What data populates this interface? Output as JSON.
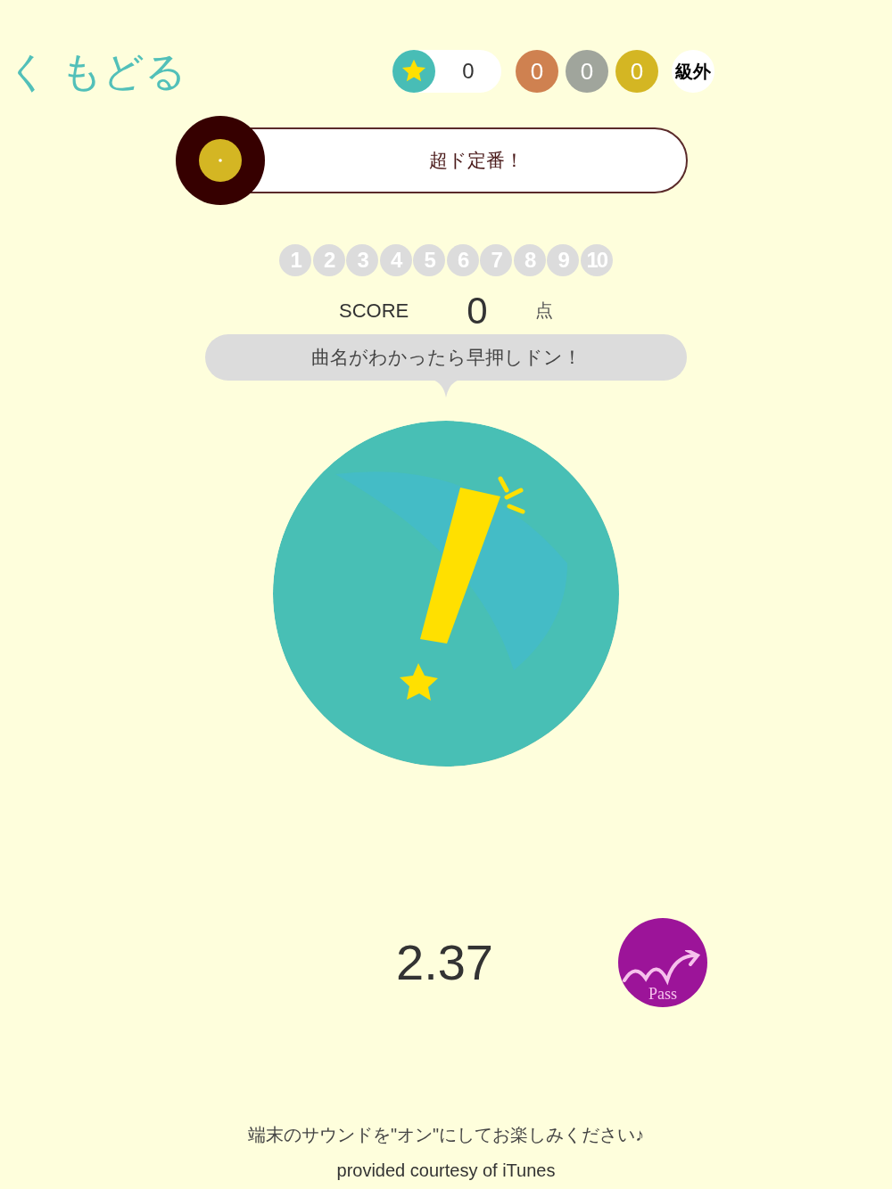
{
  "header": {
    "back_label": "く もどる",
    "star_count": "0",
    "medals": [
      {
        "value": "0",
        "color": "#cf8150"
      },
      {
        "value": "0",
        "color": "#a0a59c"
      },
      {
        "value": "0",
        "color": "#d4b623"
      }
    ],
    "rank": "級外"
  },
  "genre": {
    "label": "超ド定番！"
  },
  "questions": [
    "1",
    "2",
    "3",
    "4",
    "5",
    "6",
    "7",
    "8",
    "9",
    "10"
  ],
  "score": {
    "label": "SCORE",
    "value": "0",
    "unit": "点"
  },
  "hint": "曲名がわかったら早押しドン！",
  "timer": "2.37",
  "pass_button": {
    "label": "Pass"
  },
  "footer": {
    "notice": "端末のサウンドを\"オン\"にしてお楽しみください♪",
    "credit": "provided courtesy of iTunes"
  }
}
